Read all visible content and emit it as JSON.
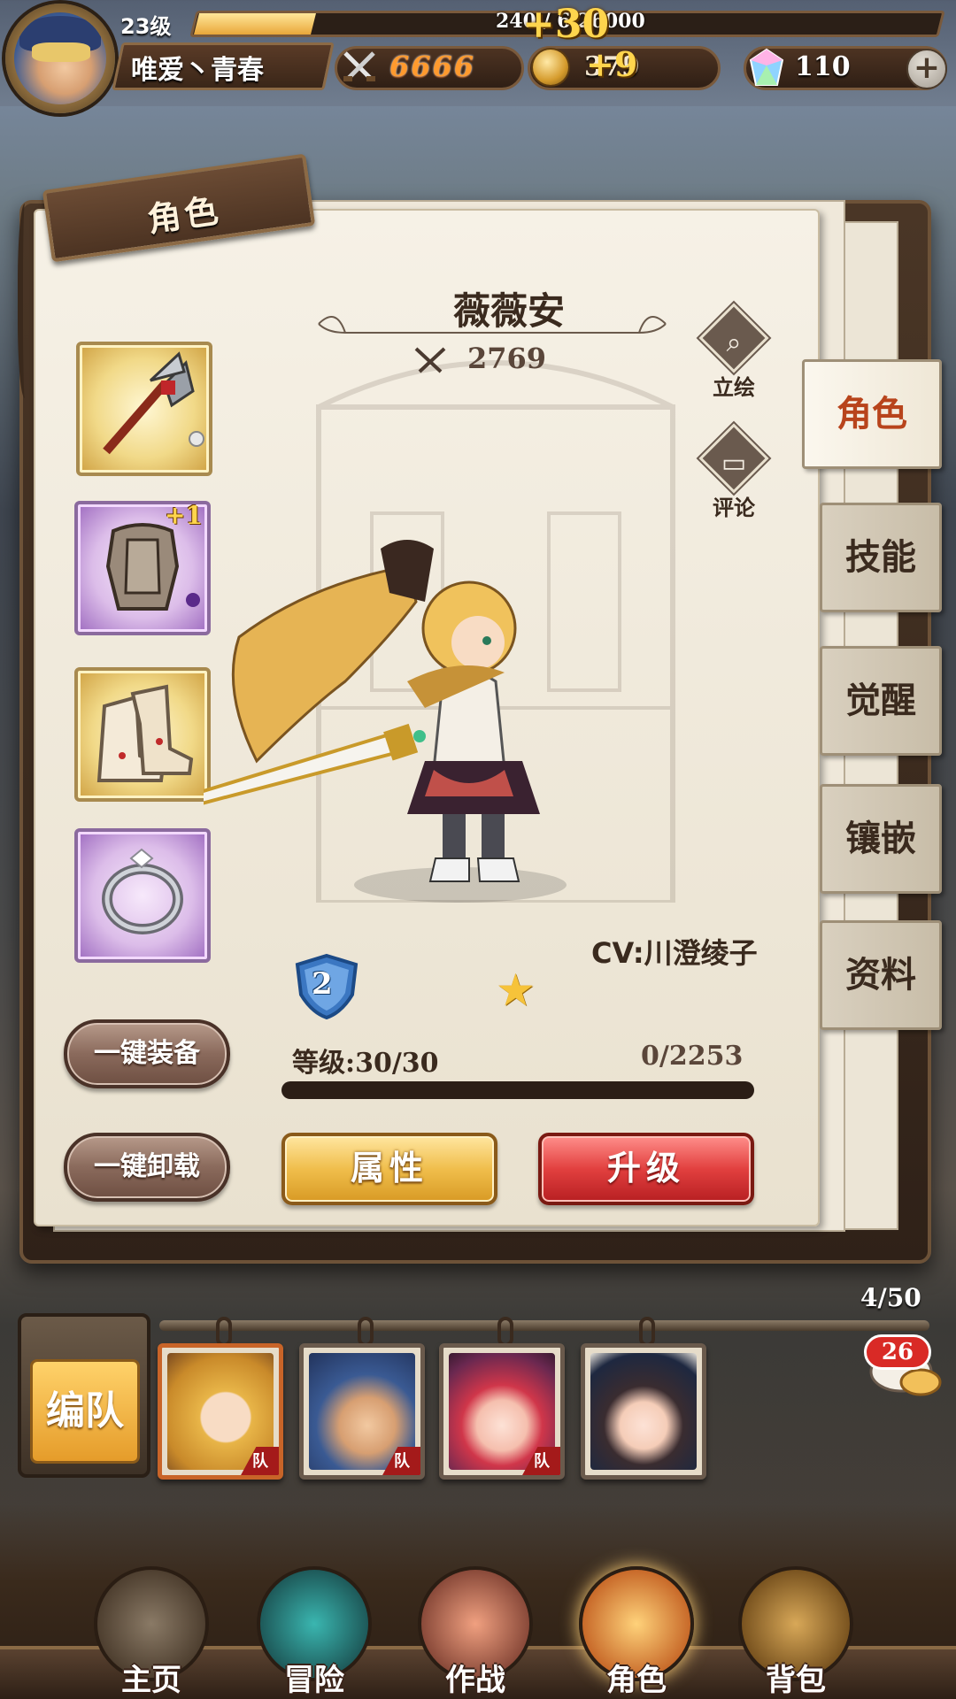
{
  "player": {
    "level": "23级",
    "exp": "240 / 6 26000",
    "exp_gain": "+30",
    "exp_fraction": 0.16,
    "name": "唯爱丶青春"
  },
  "resources": {
    "power": "6666",
    "gold": "379",
    "gold_gain": "+9",
    "gems": "110",
    "add_label": "+"
  },
  "panel": {
    "title": "角色"
  },
  "equipment": {
    "plus_badge": "+1",
    "slots": [
      {
        "name": "weapon",
        "frame": "gold"
      },
      {
        "name": "armor",
        "frame": "purple"
      },
      {
        "name": "boots",
        "frame": "gold"
      },
      {
        "name": "ring",
        "frame": "purple"
      }
    ]
  },
  "hero": {
    "name": "薇薇安",
    "power": "2769",
    "cv": "CV:川澄绫子",
    "rank": "2",
    "level": "等级:30/30",
    "exp": "0/2253",
    "exp_fraction": 0.0
  },
  "side_actions": {
    "portrait": "立绘",
    "comment": "评论"
  },
  "buttons": {
    "equip_all": "一键装备",
    "unequip_all": "一键卸载",
    "attributes": "属性",
    "upgrade": "升级",
    "team": "编队"
  },
  "tabs": [
    "角色",
    "技能",
    "觉醒",
    "镶嵌",
    "资料"
  ],
  "roster": {
    "count": "4/50",
    "team_tag": "队",
    "chat_badge": "26"
  },
  "nav": [
    "主页",
    "冒险",
    "作战",
    "角色",
    "背包"
  ],
  "colors": {
    "accent_gold": "#f0be4c",
    "accent_red": "#e2403f",
    "active_tab_text": "#b8441c",
    "paper": "#f6f1e6"
  }
}
